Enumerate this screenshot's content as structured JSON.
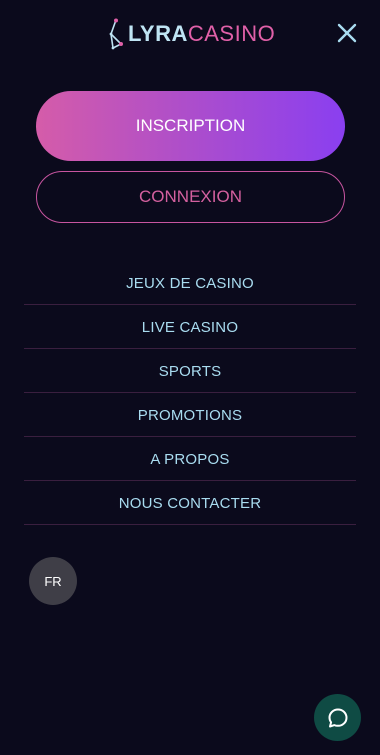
{
  "header": {
    "logo": {
      "text_primary": "LYRA",
      "text_secondary": "CASINO",
      "icon": "constellation-icon"
    },
    "close_icon": "close-icon"
  },
  "auth": {
    "register_label": "INSCRIPTION",
    "login_label": "CONNEXION"
  },
  "nav": {
    "items": [
      {
        "label": "JEUX DE CASINO"
      },
      {
        "label": "LIVE CASINO"
      },
      {
        "label": "SPORTS"
      },
      {
        "label": "PROMOTIONS"
      },
      {
        "label": "A PROPOS"
      },
      {
        "label": "NOUS CONTACTER"
      }
    ]
  },
  "language": {
    "current": "FR"
  },
  "chat": {
    "icon": "chat-bubble-icon"
  },
  "colors": {
    "background": "#0b0a1c",
    "accent_pink": "#d4609f",
    "accent_purple": "#8a3ff0",
    "nav_text": "#a9dcf0",
    "chat_button": "#0f4b44"
  }
}
